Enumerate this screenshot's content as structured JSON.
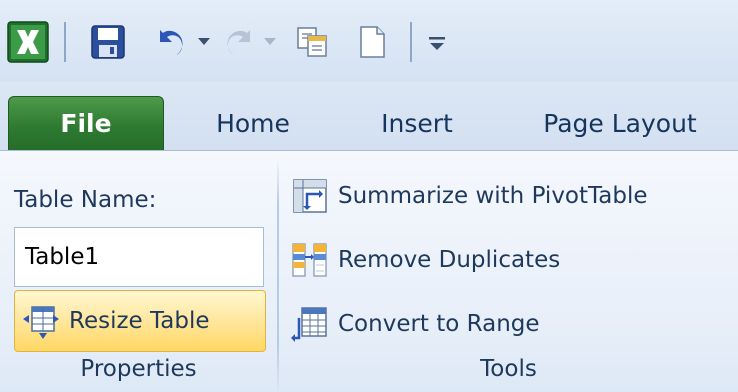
{
  "quick_access_toolbar": {
    "icons": [
      "excel-logo-icon",
      "save-icon",
      "undo-icon",
      "dropdown-arrow-icon",
      "redo-icon",
      "dropdown-arrow-icon",
      "copy-icon",
      "new-document-icon",
      "customize-toolbar-icon"
    ]
  },
  "tabs": [
    {
      "label": "File",
      "color": "#2e7b32"
    },
    {
      "label": "Home"
    },
    {
      "label": "Insert"
    },
    {
      "label": "Page Layout"
    }
  ],
  "properties": {
    "table_name_label": "Table Name:",
    "table_name_value": "Table1",
    "resize_table_label": "Resize Table",
    "resize_table_icon": "resize-table-icon",
    "group_label": "Properties"
  },
  "tools": {
    "summarize_label": "Summarize with PivotTable",
    "summarize_icon": "pivot-table-icon",
    "remove_duplicates_label": "Remove Duplicates",
    "remove_duplicates_icon": "remove-duplicates-icon",
    "convert_label": "Convert to Range",
    "convert_icon": "convert-range-icon",
    "group_label": "Tools"
  },
  "colors": {
    "ribbon_text": "#1e395b",
    "file_tab": "#2e7b32",
    "hover_button": "#ffd764"
  }
}
